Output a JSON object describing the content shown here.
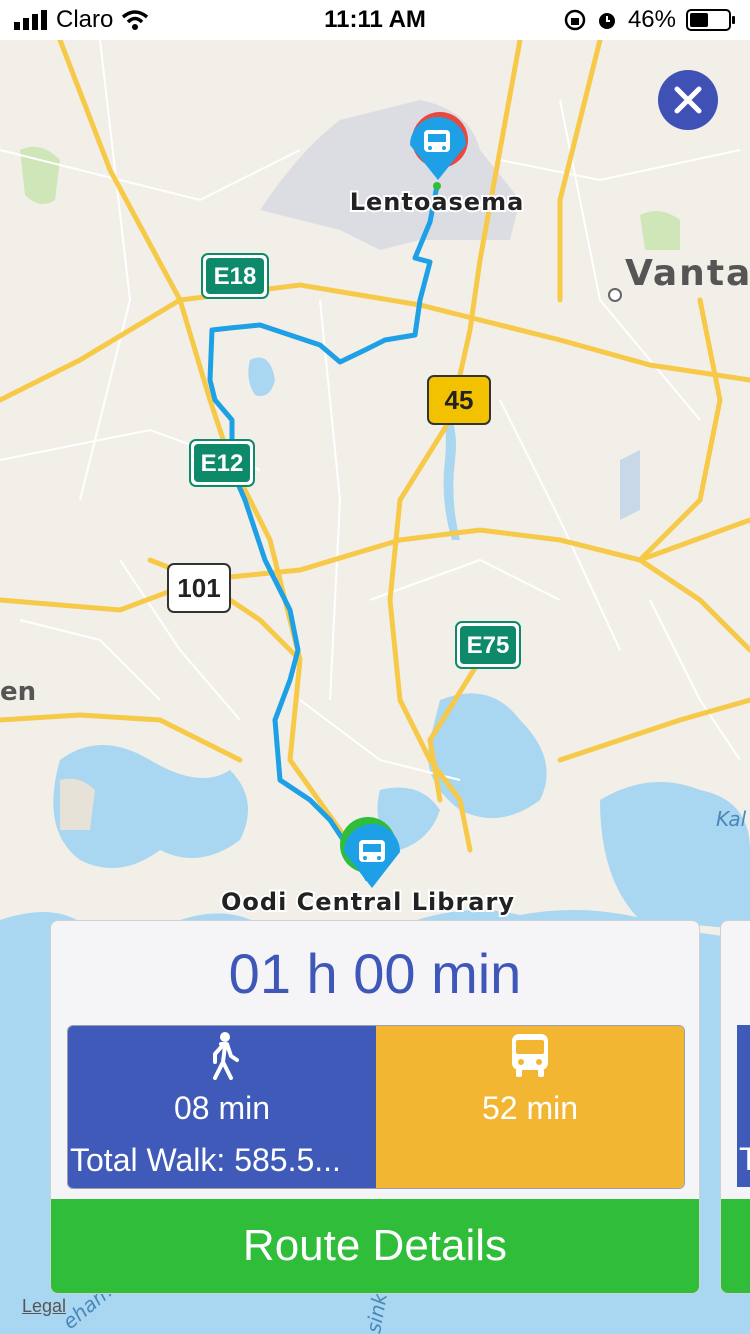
{
  "status_bar": {
    "carrier": "Claro",
    "time": "11:11 AM",
    "battery": "46%",
    "battery_level": 0.46
  },
  "map": {
    "labels": {
      "destination": "Lentoasema",
      "origin": "Oodi Central Library",
      "city": "Vantaa",
      "partial_left": "en",
      "partial_right": "Kal",
      "partial_bottom_left": "eham",
      "partial_bottom": "sink"
    },
    "road_shields": {
      "e18": "E18",
      "e12": "E12",
      "e75": "E75",
      "r45": "45",
      "r101": "101"
    },
    "colors": {
      "route": "#1ea0e6",
      "origin_pin": "#2fbd3a",
      "destination_pin": "#e8483f",
      "bus_pin": "#1ea0e6"
    },
    "legal": "Legal"
  },
  "route_card": {
    "duration": "01 h 00 min",
    "walk": {
      "icon": "walking-person-icon",
      "time": "08 min",
      "total": "Total Walk: 585.5..."
    },
    "bus": {
      "icon": "bus-icon",
      "time": "52 min"
    },
    "details_button": "Route Details",
    "colors": {
      "walk": "#3f5ab8",
      "bus": "#f3b633",
      "button": "#2fbd3a",
      "duration_text": "#3f57b8"
    }
  },
  "next_card": {
    "partial_text": "T"
  }
}
